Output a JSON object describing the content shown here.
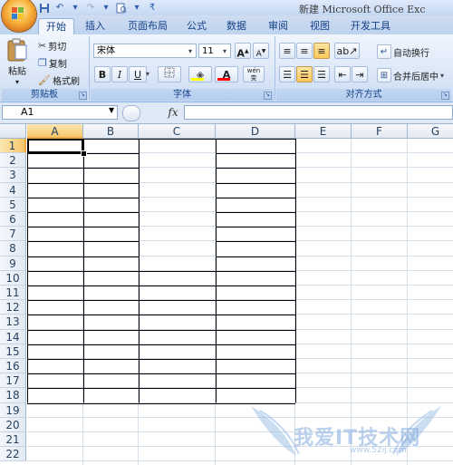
{
  "title_bar": {
    "title": "新建 Microsoft Office Exc"
  },
  "quick_access": {
    "icons": [
      "save-icon",
      "undo-icon",
      "redo-icon",
      "print-preview-icon",
      "qat-dropdown-icon"
    ]
  },
  "tabs": [
    {
      "label": "开始",
      "active": true
    },
    {
      "label": "插入"
    },
    {
      "label": "页面布局"
    },
    {
      "label": "公式"
    },
    {
      "label": "数据"
    },
    {
      "label": "审阅"
    },
    {
      "label": "视图"
    },
    {
      "label": "开发工具"
    }
  ],
  "ribbon": {
    "clipboard": {
      "label": "剪贴板",
      "paste": "粘贴",
      "cut": "剪切",
      "copy": "复制",
      "format_painter": "格式刷"
    },
    "font": {
      "label": "字体",
      "font_name": "宋体",
      "font_size": "11",
      "bold": "B",
      "italic": "I",
      "underline": "U",
      "wen": "wén 变",
      "font_color": "A",
      "grow": "A",
      "shrink": "A"
    },
    "alignment": {
      "label": "对齐方式",
      "wrap_text": "自动换行",
      "merge_center": "合并后居中"
    }
  },
  "formula_bar": {
    "name_box": "A1",
    "fx": "fx",
    "formula": ""
  },
  "columns": [
    "A",
    "B",
    "C",
    "D",
    "E",
    "F",
    "G"
  ],
  "rows": [
    "1",
    "2",
    "3",
    "4",
    "5",
    "6",
    "7",
    "8",
    "9",
    "10",
    "11",
    "12",
    "13",
    "14",
    "15",
    "16",
    "17",
    "18",
    "19",
    "20",
    "21",
    "22"
  ],
  "selection": {
    "cell": "A1",
    "column": "A",
    "row": "1"
  },
  "watermark": {
    "text": "我爱IT技术网",
    "url": "www.52ij.com"
  },
  "colors": {
    "accent": "#15428b",
    "selected_header": "#f6c66b",
    "border": "#000000"
  }
}
